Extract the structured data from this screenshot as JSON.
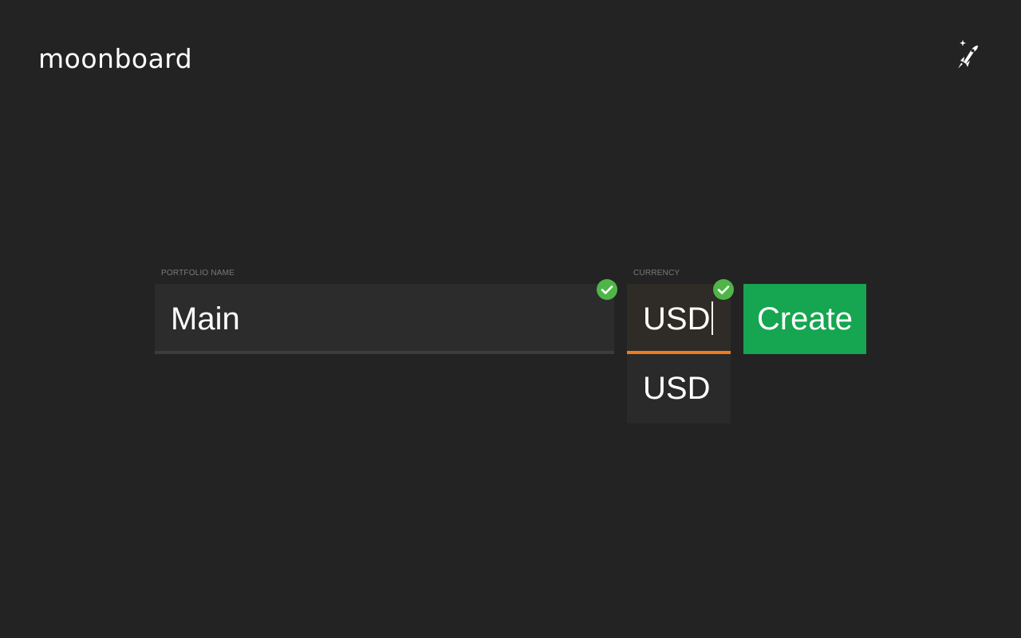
{
  "app": {
    "title": "moonboard",
    "logo_icon": "rocket-moon-icon"
  },
  "form": {
    "portfolio_name": {
      "label": "PORTFOLIO NAME",
      "value": "Main",
      "valid": true,
      "valid_icon": "check-circle-icon"
    },
    "currency": {
      "label": "CURRENCY",
      "value": "USD",
      "valid": true,
      "valid_icon": "check-circle-icon",
      "focused": true,
      "options": [
        "USD"
      ]
    },
    "create_label": "Create"
  },
  "colors": {
    "background": "#232323",
    "field_background": "#2c2c2c",
    "focus_underline": "#f07a1e",
    "valid_check": "#4fb548",
    "create_button": "#16a550"
  }
}
